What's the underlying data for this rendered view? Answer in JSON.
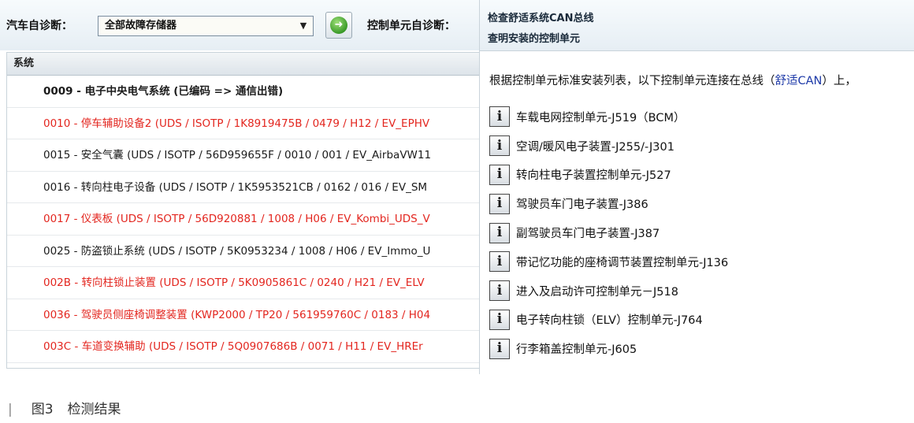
{
  "toolbar": {
    "auto_diag_label": "汽车自诊断：",
    "select_value": "全部故障存储器",
    "unit_diag_label": "控制单元自诊断："
  },
  "list": {
    "header": "系统",
    "rows": [
      {
        "text": "0009 - 电子中央电气系统 (已编码 => 通信出错)",
        "style": "bold"
      },
      {
        "text": "0010 - 停车辅助设备2 (UDS / ISOTP / 1K8919475B / 0479 / H12 / EV_EPHV",
        "style": "red"
      },
      {
        "text": "0015 - 安全气囊 (UDS / ISOTP / 56D959655F / 0010 / 001 / EV_AirbaVW11",
        "style": "black"
      },
      {
        "text": "0016 - 转向柱电子设备 (UDS / ISOTP / 1K5953521CB / 0162 / 016 / EV_SM",
        "style": "black"
      },
      {
        "text": "0017 - 仪表板 (UDS / ISOTP / 56D920881 / 1008 / H06 / EV_Kombi_UDS_V",
        "style": "red"
      },
      {
        "text": "0025 - 防盗锁止系统 (UDS / ISOTP / 5K0953234 / 1008 / H06 / EV_Immo_U",
        "style": "black"
      },
      {
        "text": "002B - 转向柱锁止装置 (UDS / ISOTP / 5K0905861C / 0240 / H21 / EV_ELV",
        "style": "red"
      },
      {
        "text": "0036 - 驾驶员侧座椅调整装置 (KWP2000 / TP20 / 561959760C / 0183 / H04",
        "style": "red"
      },
      {
        "text": "003C - 车道变换辅助 (UDS / ISOTP / 5Q0907686B / 0071 / H11 / EV_HREr",
        "style": "red"
      }
    ]
  },
  "detail": {
    "heading1": "检查舒适系统CAN总线",
    "heading2": "查明安装的控制单元",
    "intro_prefix": "根据控制单元标准安装列表，以下控制单元连接在总线（",
    "intro_bus": "舒适CAN",
    "intro_suffix": "）上，",
    "units": [
      "车载电网控制单元-J519（BCM）",
      "空调/暖风电子装置-J255/-J301",
      "转向柱电子装置控制单元-J527",
      "驾驶员车门电子装置-J386",
      "副驾驶员车门电子装置-J387",
      "带记忆功能的座椅调节装置控制单元-J136",
      "进入及启动许可控制单元－J518",
      "电子转向柱锁（ELV）控制单元-J764",
      "行李箱盖控制单元-J605"
    ]
  },
  "caption": {
    "bar": "|",
    "figure": "图3",
    "title": "检测结果"
  },
  "icons": {
    "go": "arrow-right-icon",
    "info": "info-icon",
    "dropdown": "chevron-down-icon"
  }
}
